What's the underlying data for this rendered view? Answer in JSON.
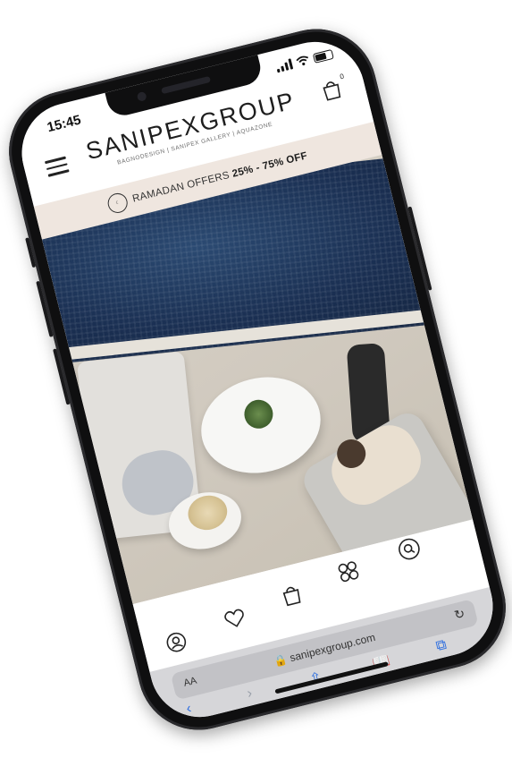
{
  "status_bar": {
    "time": "15:45",
    "signal_icon": "signal-bars-icon",
    "wifi_icon": "wifi-icon",
    "battery_icon": "battery-icon"
  },
  "header": {
    "menu_icon": "hamburger-menu-icon",
    "brand_name": "SANIPEXGROUP",
    "brand_sub": "BAGNODESIGN | SANIPEX GALLERY | AQUAZONE",
    "cart_icon": "shopping-bag-icon",
    "cart_count": "0"
  },
  "promo": {
    "logo_icon": "crescent-lantern-logo-icon",
    "text": "RAMADAN OFFERS",
    "highlight": "25% - 75% OFF"
  },
  "hero": {
    "image_icon": "hero-photo-pool-lounge"
  },
  "quick_nav": {
    "items": [
      {
        "name": "account",
        "icon": "user-circle-icon"
      },
      {
        "name": "wishlist",
        "icon": "heart-icon"
      },
      {
        "name": "bag",
        "icon": "shopping-bag-icon"
      },
      {
        "name": "categories",
        "icon": "grid-four-icon"
      },
      {
        "name": "search",
        "icon": "search-icon"
      }
    ]
  },
  "browser": {
    "aa_label": "AA",
    "url": "sanipexgroup.com",
    "reload_icon": "reload-icon",
    "back_icon": "back-chevron-icon",
    "forward_icon": "forward-chevron-icon",
    "share_icon": "share-icon",
    "bookmarks_icon": "book-icon",
    "tabs_icon": "tabs-icon"
  },
  "colors": {
    "accent_blue": "#2f6fe0",
    "promo_bg": "#efe6df",
    "pool_blue": "#1a2f52",
    "text_dark": "#1e1e1e"
  }
}
